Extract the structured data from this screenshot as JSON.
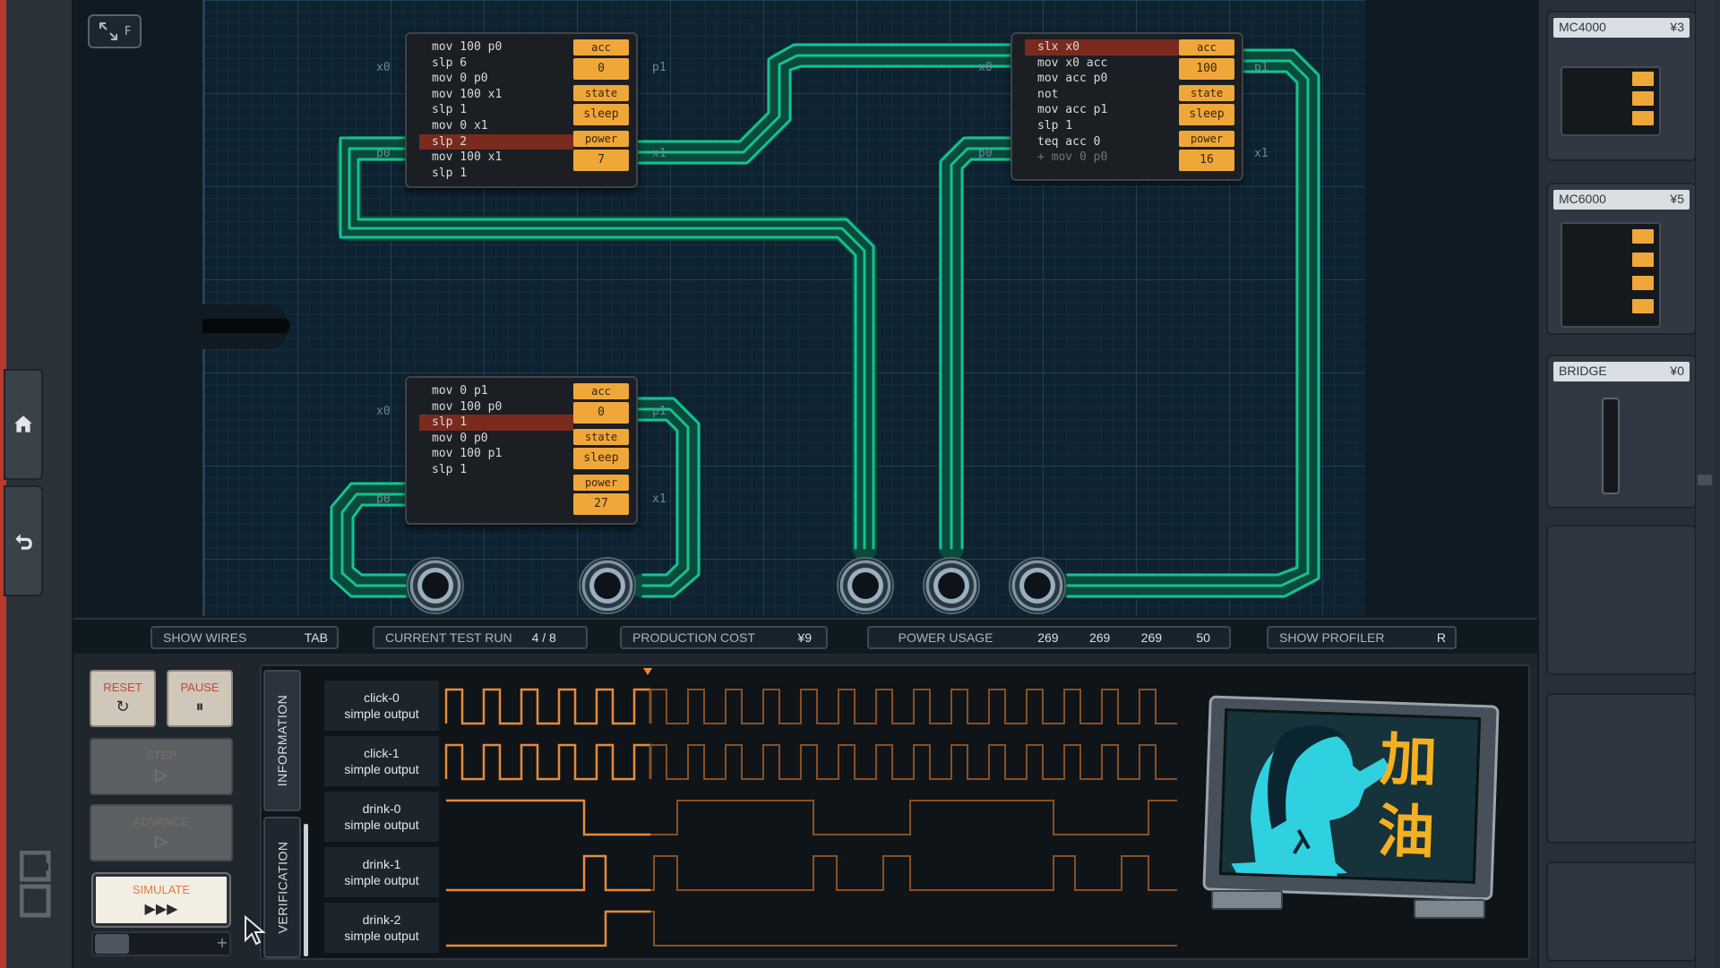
{
  "toolbar": {
    "zoom_label": "F"
  },
  "chips": [
    {
      "code": [
        "mov 100 p0",
        "slp 6",
        "mov 0 p0",
        "mov 100 x1",
        "slp 1",
        "mov 0 x1",
        "slp 2",
        "mov 100 x1",
        "slp 1"
      ],
      "active_line": 6,
      "registers": [
        {
          "label": "acc",
          "value": "0"
        },
        {
          "label": "state",
          "value": "sleep"
        },
        {
          "label": "power",
          "value": "7"
        }
      ],
      "pins": {
        "x0": "x0",
        "p0": "p0",
        "p1": "p1",
        "x1": "x1"
      }
    },
    {
      "code": [
        "slx x0",
        "mov x0 acc",
        "mov acc p0",
        "not",
        "mov acc p1",
        "slp 1",
        "teq acc 0",
        "+ mov 0 p0"
      ],
      "active_line": 0,
      "registers": [
        {
          "label": "acc",
          "value": "100"
        },
        {
          "label": "state",
          "value": "sleep"
        },
        {
          "label": "power",
          "value": "16"
        }
      ],
      "pins": {
        "x0": "x0",
        "p0": "p0",
        "p1": "p1",
        "x1": "x1"
      }
    },
    {
      "code": [
        "mov 0 p1",
        "mov 100 p0",
        "slp 1",
        "mov 0 p0",
        "mov 100 p1",
        "slp 1"
      ],
      "active_line": 2,
      "registers": [
        {
          "label": "acc",
          "value": "0"
        },
        {
          "label": "state",
          "value": "sleep"
        },
        {
          "label": "power",
          "value": "27"
        }
      ],
      "pins": {
        "x0": "x0",
        "p0": "p0",
        "p1": "p1",
        "x1": "x1"
      }
    }
  ],
  "parts": [
    {
      "name": "MC4000",
      "cost": "¥3"
    },
    {
      "name": "MC6000",
      "cost": "¥5"
    },
    {
      "name": "BRIDGE",
      "cost": "¥0"
    }
  ],
  "status": {
    "show_wires": {
      "label": "SHOW WIRES",
      "key": "TAB"
    },
    "test_run": {
      "label": "CURRENT TEST RUN",
      "value": "4 / 8"
    },
    "production_cost": {
      "label": "PRODUCTION COST",
      "value": "¥9"
    },
    "power_usage": {
      "label": "POWER USAGE",
      "values": [
        "269",
        "269",
        "269",
        "50"
      ]
    },
    "show_profiler": {
      "label": "SHOW PROFILER",
      "key": "R"
    }
  },
  "controls": {
    "reset": "RESET",
    "pause": "PAUSE",
    "step": "STEP",
    "advance": "ADVANCE",
    "simulate": "SIMULATE",
    "simulate_glyph": "▶▶▶",
    "pause_glyph": "⏸",
    "reset_glyph": "↻",
    "play_glyph": "▷",
    "plus_glyph": "+"
  },
  "tabs": {
    "information": "INFORMATION",
    "verification": "VERIFICATION"
  },
  "signals": [
    {
      "name": "click-0",
      "type": "simple output"
    },
    {
      "name": "click-1",
      "type": "simple output"
    },
    {
      "name": "drink-0",
      "type": "simple output"
    },
    {
      "name": "drink-1",
      "type": "simple output"
    },
    {
      "name": "drink-2",
      "type": "simple output"
    }
  ],
  "monitor": {
    "text_line1": "加",
    "text_line2": "油"
  },
  "colors": {
    "wire": "#16c79a",
    "register": "#f0a73a",
    "active_line": "#7a2b1e",
    "wave": "#e8893a"
  },
  "icons": {
    "home": "home-icon",
    "undo": "undo-icon",
    "zoom": "zoom-expand-icon"
  }
}
